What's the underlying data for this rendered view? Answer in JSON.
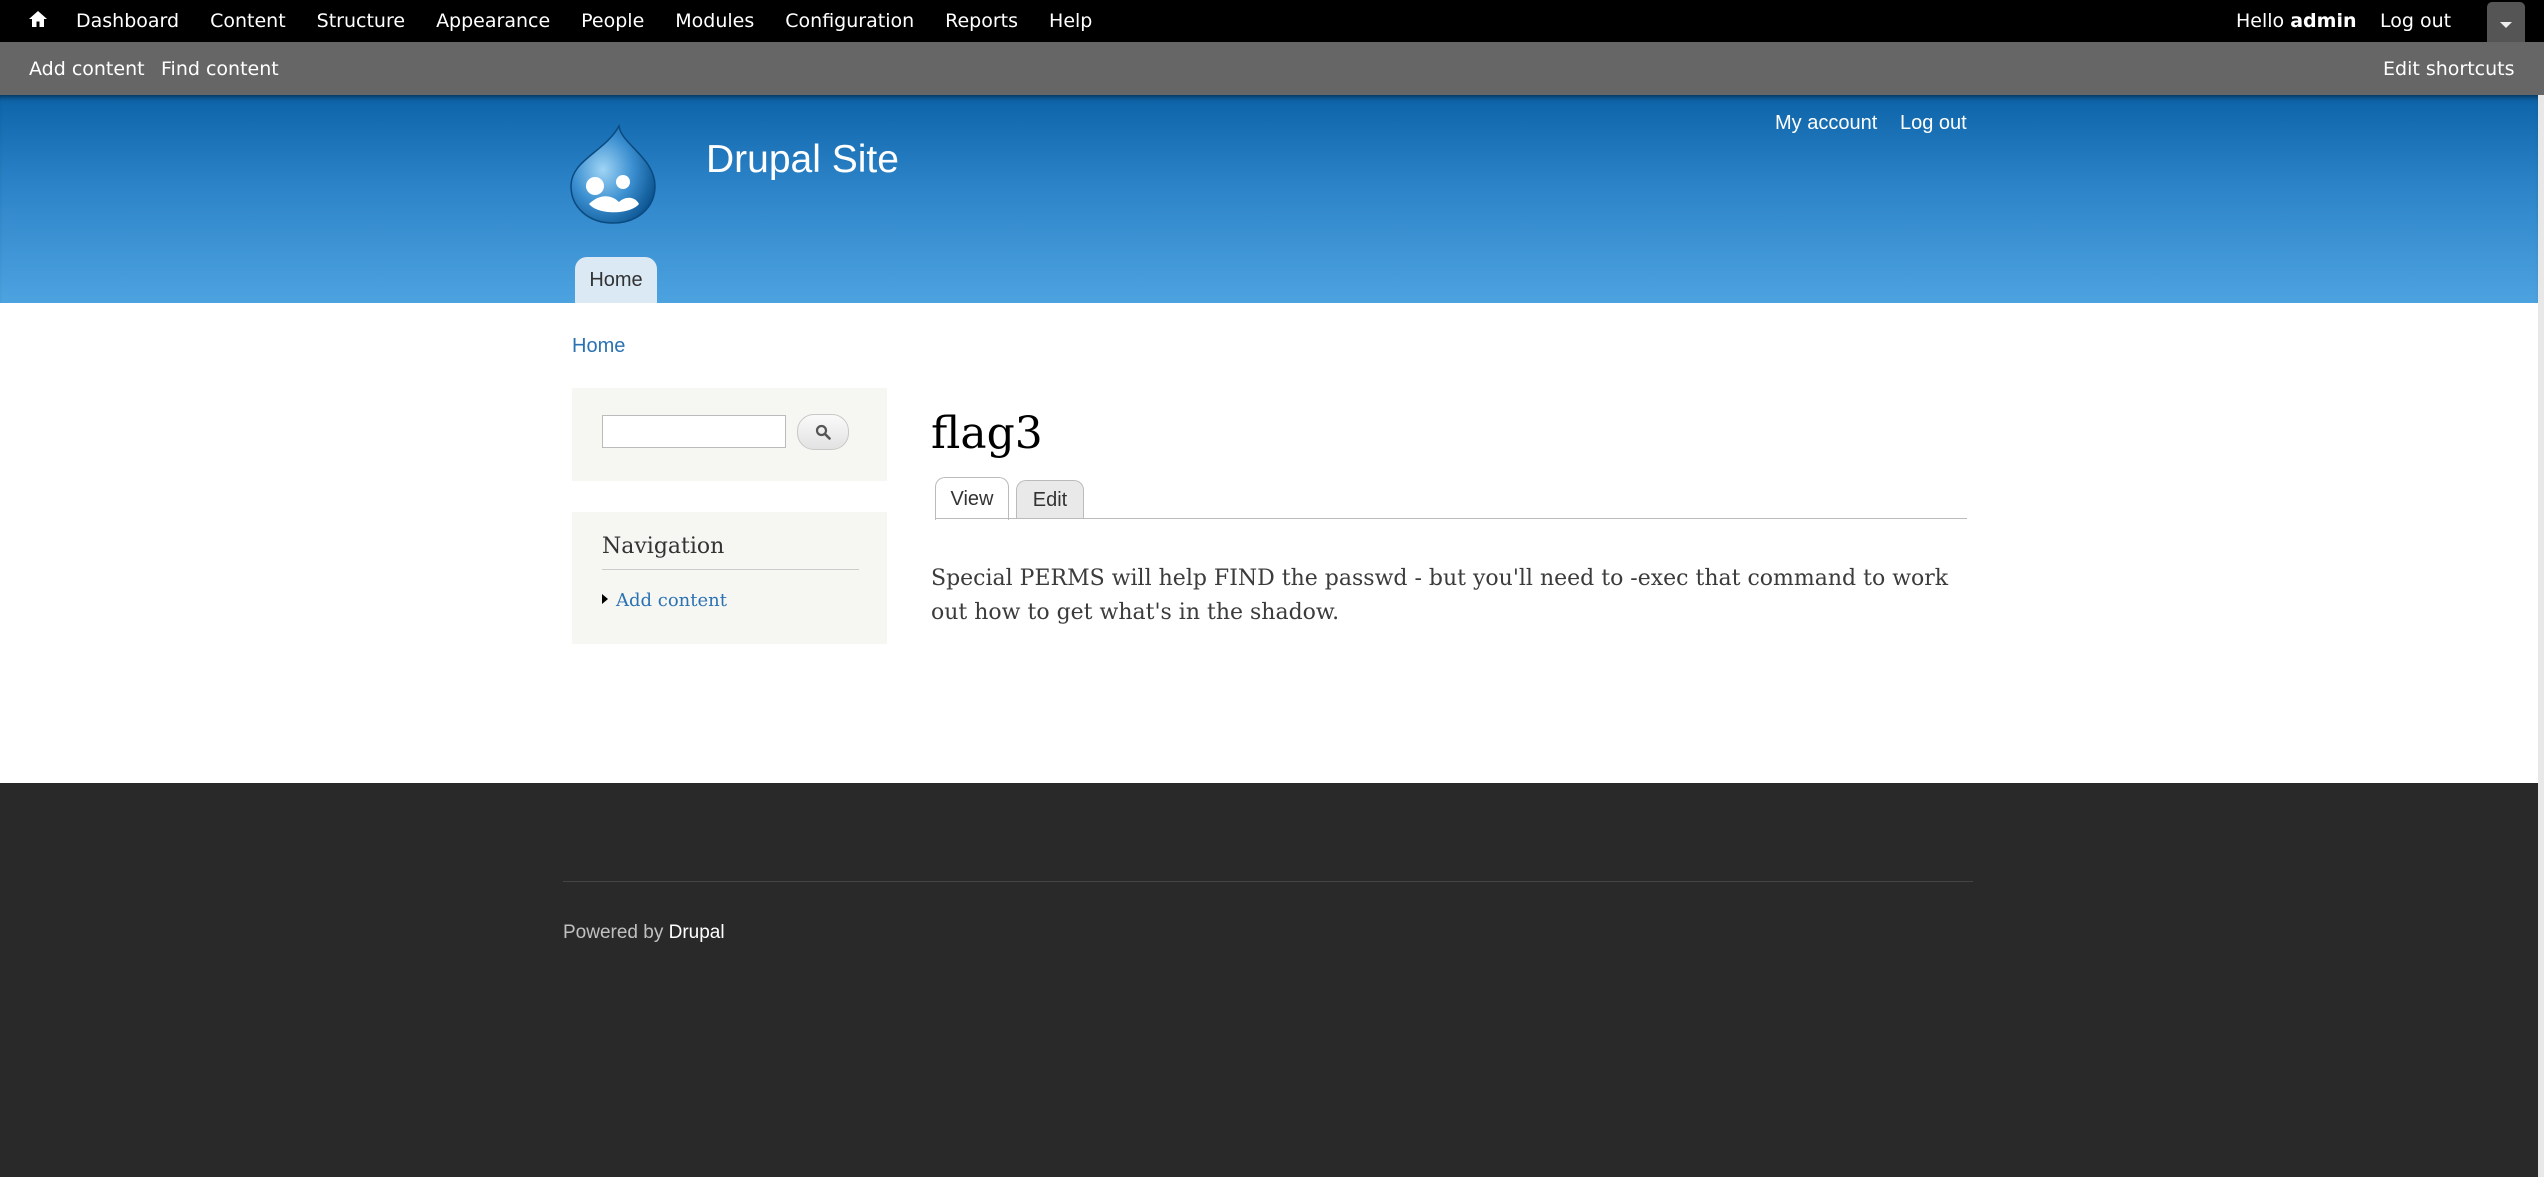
{
  "toolbar": {
    "home_icon": "home-icon",
    "menu": [
      "Dashboard",
      "Content",
      "Structure",
      "Appearance",
      "People",
      "Modules",
      "Configuration",
      "Reports",
      "Help"
    ],
    "greeting": "Hello",
    "username": "admin",
    "logout": "Log out",
    "drawer_icon": "chevron-down-icon"
  },
  "shortcuts": {
    "add_content": "Add content",
    "find_content": "Find content",
    "edit_shortcuts": "Edit shortcuts"
  },
  "header": {
    "site_name": "Drupal Site",
    "my_account": "My account",
    "logout": "Log out",
    "main_tab": "Home",
    "colors": {
      "accent": "#2d84c8",
      "link": "#2b72b3"
    }
  },
  "breadcrumb": "Home",
  "search": {
    "value": "",
    "button_icon": "search-icon"
  },
  "navigation": {
    "title": "Navigation",
    "items": [
      "Add content"
    ]
  },
  "node": {
    "title": "flag3",
    "tabs": [
      "View",
      "Edit"
    ],
    "active_tab": "View",
    "body": "Special PERMS will help FIND the passwd - but you'll need to -exec that command to work out how to get what's in the shadow."
  },
  "footer": {
    "powered_by": "Powered by",
    "drupal_link": "Drupal"
  }
}
